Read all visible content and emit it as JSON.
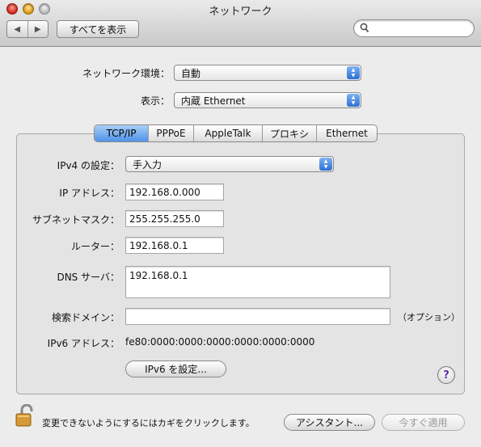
{
  "window": {
    "title": "ネットワーク"
  },
  "toolbar": {
    "show_all_label": "すべてを表示",
    "search_placeholder": ""
  },
  "location": {
    "label": "ネットワーク環境：",
    "value": "自動"
  },
  "show": {
    "label": "表示：",
    "value": "内蔵 Ethernet"
  },
  "tabs": [
    {
      "label": "TCP/IP",
      "active": true
    },
    {
      "label": "PPPoE",
      "active": false
    },
    {
      "label": "AppleTalk",
      "active": false
    },
    {
      "label": "プロキシ",
      "active": false
    },
    {
      "label": "Ethernet",
      "active": false
    }
  ],
  "tcpip": {
    "ipv4_config": {
      "label": "IPv4 の設定：",
      "value": "手入力"
    },
    "ip_address": {
      "label": "IP アドレス：",
      "value": "192.168.0.000"
    },
    "subnet_mask": {
      "label": "サブネットマスク：",
      "value": "255.255.255.0"
    },
    "router": {
      "label": "ルーター：",
      "value": "192.168.0.1"
    },
    "dns": {
      "label": "DNS サーバ：",
      "value": "192.168.0.1"
    },
    "search_domains": {
      "label": "検索ドメイン：",
      "value": "",
      "hint": "（オプション）"
    },
    "ipv6_address": {
      "label": "IPv6 アドレス：",
      "value": "fe80:0000:0000:0000:0000:0000:0000"
    },
    "configure_ipv6_label": "IPv6 を設定..."
  },
  "footer": {
    "lock_text": "変更できないようにするにはカギをクリックします。",
    "assistant_label": "アシスタント...",
    "apply_label": "今すぐ適用"
  }
}
